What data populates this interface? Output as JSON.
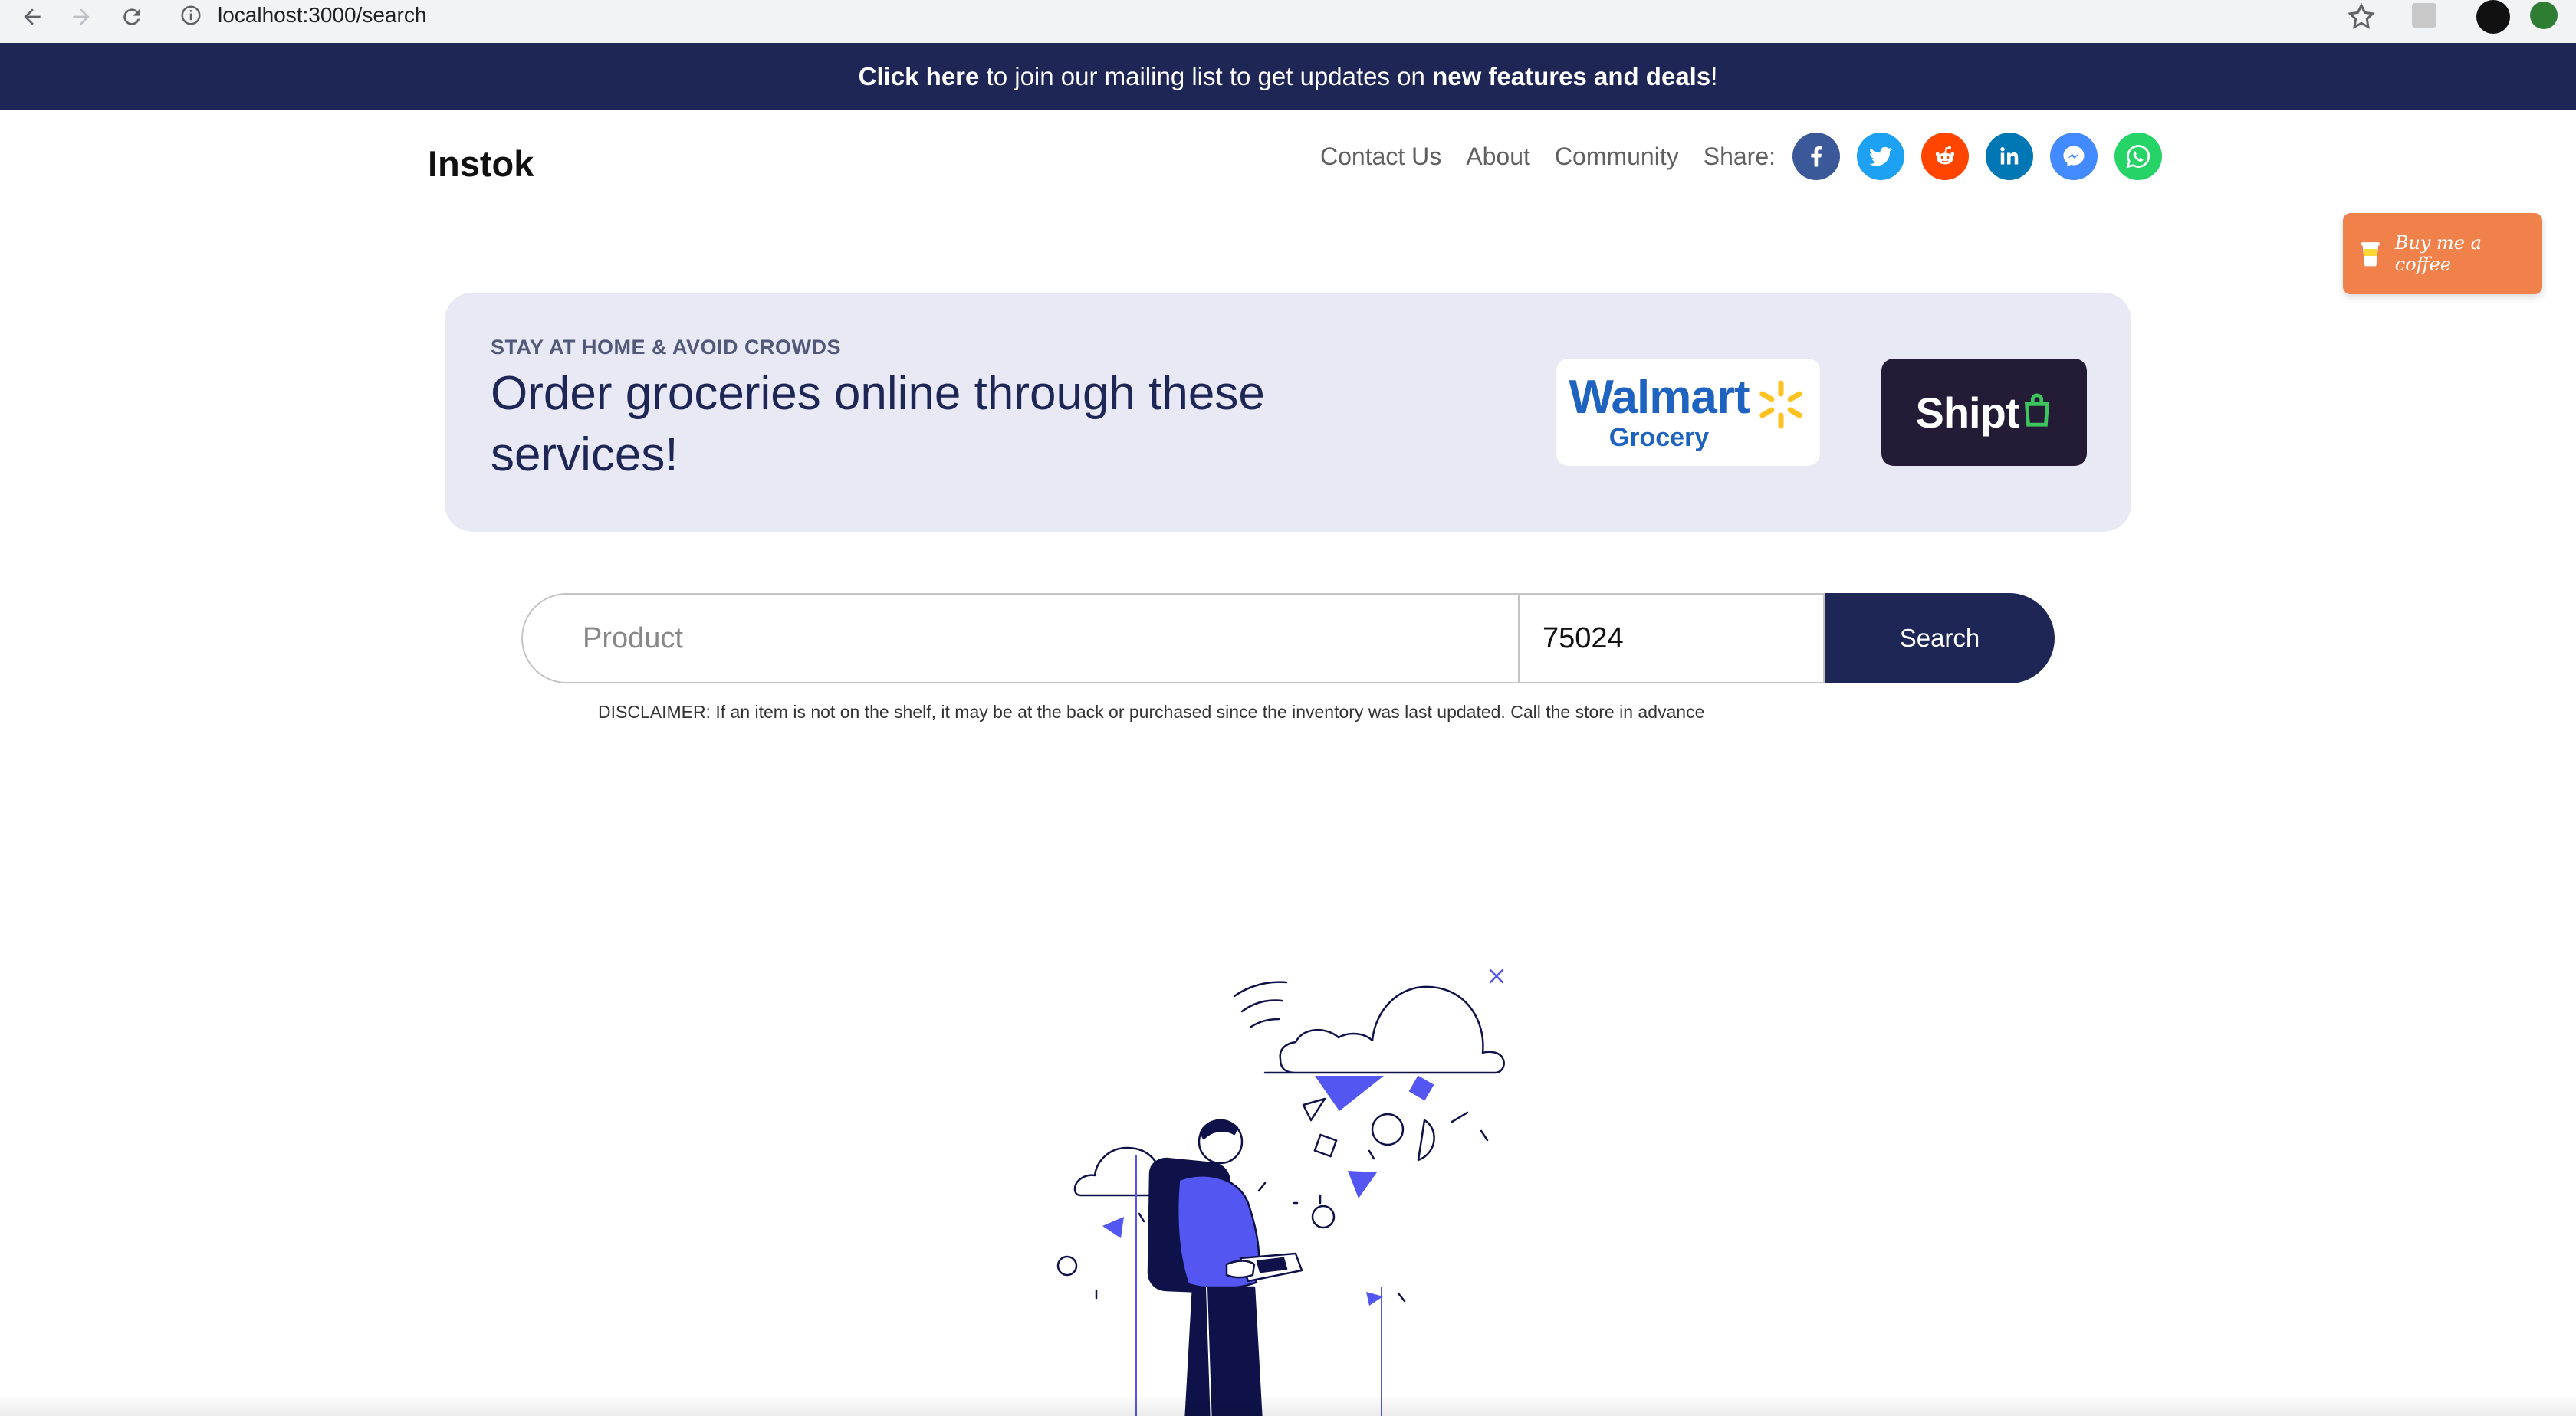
{
  "browser": {
    "url": "localhost:3000/search"
  },
  "banner": {
    "link": "Click here",
    "middle": " to join our mailing list to get updates on ",
    "emphasis": "new features and deals",
    "end": "!"
  },
  "header": {
    "logo": "Instok",
    "nav": [
      "Contact Us",
      "About",
      "Community"
    ],
    "share_label": "Share:",
    "social": [
      {
        "name": "facebook",
        "color": "#3b5998",
        "glyph": "f"
      },
      {
        "name": "twitter",
        "color": "#1da1f2",
        "glyph": "t"
      },
      {
        "name": "reddit",
        "color": "#ff4500",
        "glyph": "r"
      },
      {
        "name": "linkedin",
        "color": "#0077b5",
        "glyph": "in"
      },
      {
        "name": "messenger",
        "color": "#448aff",
        "glyph": "m"
      },
      {
        "name": "whatsapp",
        "color": "#25d366",
        "glyph": "w"
      }
    ]
  },
  "coffee": {
    "label": "Buy me a coffee",
    "color": "#f0814b"
  },
  "promo": {
    "eyebrow": "STAY AT HOME & AVOID CROWDS",
    "headline": "Order groceries online through these services!",
    "walmart_line1": "Walmart",
    "walmart_line2": "Grocery",
    "shipt": "Shipt"
  },
  "search": {
    "product_placeholder": "Product",
    "zip_value": "75024",
    "button": "Search"
  },
  "disclaimer": "DISCLAIMER: If an item is not on the shelf, it may be at the back or purchased since the inventory was last updated. Call the store in advance",
  "colors": {
    "navy": "#1e2656",
    "accent": "#5356f0",
    "promo_bg": "#e9e9f6"
  }
}
